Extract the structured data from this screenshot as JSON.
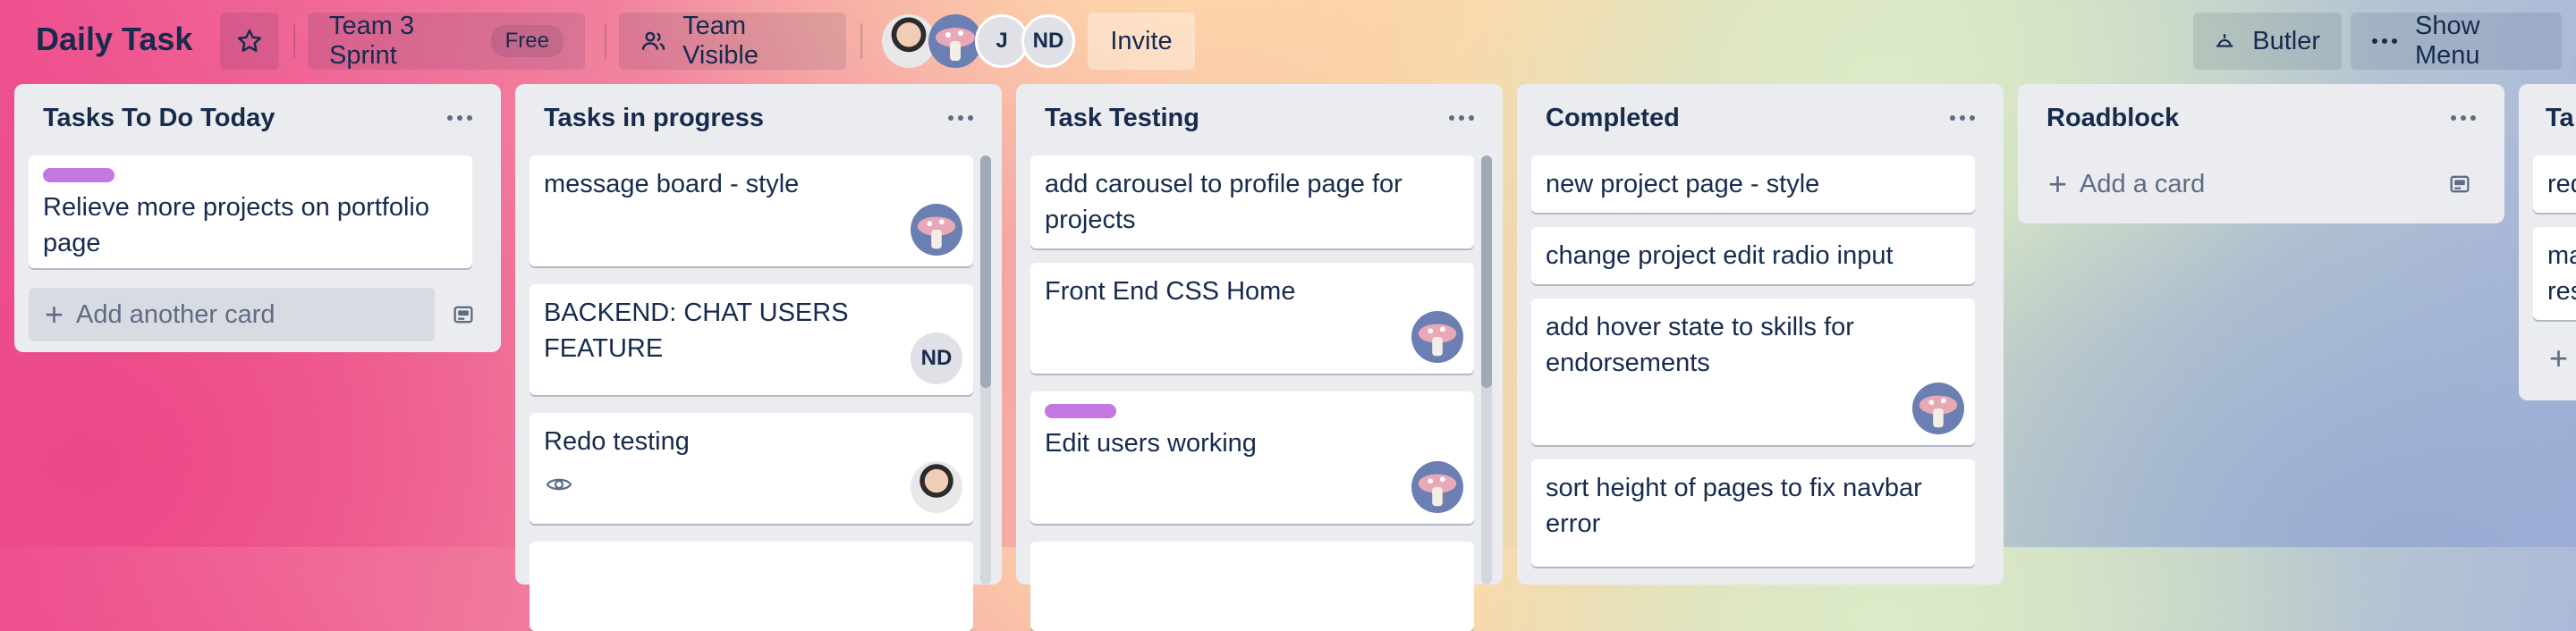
{
  "header": {
    "board_title": "Daily Task",
    "workspace": "Team 3 Sprint",
    "workspace_badge": "Free",
    "visibility": "Team Visible",
    "member_initials": [
      "J",
      "ND"
    ],
    "invite": "Invite",
    "butler": "Butler",
    "show_menu": "Show Menu"
  },
  "lists": [
    {
      "title": "Tasks To Do Today",
      "cards": [
        {
          "title": "Relieve more projects on portfolio page",
          "label_color": "#c377e0"
        }
      ],
      "add_card": "Add another card"
    },
    {
      "title": "Tasks in progress",
      "cards": [
        {
          "title": "message board - style",
          "avatar": "mushroom-avatar"
        },
        {
          "title": "BACKEND: CHAT USERS FEATURE",
          "avatar_initials": "ND"
        },
        {
          "title": "Redo testing",
          "avatar": "photo-avatar",
          "icon": "eye-icon"
        }
      ]
    },
    {
      "title": "Task Testing",
      "cards": [
        {
          "title": "add carousel to profile page for projects"
        },
        {
          "title": "Front End CSS Home",
          "avatar": "mushroom-avatar"
        },
        {
          "title": "Edit users working",
          "label_color": "#c377e0",
          "avatar": "mushroom-avatar"
        }
      ]
    },
    {
      "title": "Completed",
      "cards": [
        {
          "title": "new project page - style"
        },
        {
          "title": "change project edit radio input"
        },
        {
          "title": "add hover state to skills for endorsements",
          "avatar": "mushroom-avatar"
        },
        {
          "title": "sort height of pages to fix navbar error"
        }
      ]
    },
    {
      "title": "Roadblock",
      "add_card": "Add a card"
    },
    {
      "title": "Ta",
      "cards": [
        {
          "title": "red"
        },
        {
          "title": "ma\nres"
        }
      ]
    }
  ],
  "colors": {
    "list_bg": "#ebecf0",
    "text": "#172b4d",
    "muted": "#5e6c84",
    "label_purple": "#c377e0"
  }
}
